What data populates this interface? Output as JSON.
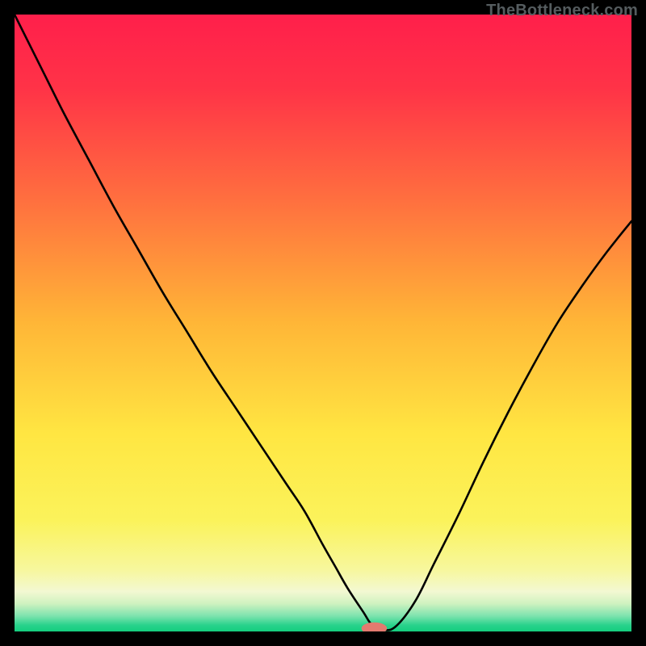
{
  "watermark": "TheBottleneck.com",
  "colors": {
    "frame": "#000000",
    "curve": "#000000",
    "marker_fill": "#E37A6F",
    "marker_stroke": "#E37A6F"
  },
  "chart_data": {
    "type": "line",
    "title": "",
    "xlabel": "",
    "ylabel": "",
    "xlim": [
      0,
      100
    ],
    "ylim": [
      0,
      100
    ],
    "annotations": [],
    "gradient_stops": [
      {
        "offset": 0.0,
        "color": "#FF1F4B"
      },
      {
        "offset": 0.12,
        "color": "#FF3347"
      },
      {
        "offset": 0.3,
        "color": "#FF6F3F"
      },
      {
        "offset": 0.5,
        "color": "#FFB637"
      },
      {
        "offset": 0.68,
        "color": "#FFE642"
      },
      {
        "offset": 0.82,
        "color": "#FBF35B"
      },
      {
        "offset": 0.9,
        "color": "#F7F79D"
      },
      {
        "offset": 0.935,
        "color": "#F3F8D2"
      },
      {
        "offset": 0.955,
        "color": "#CFF2C0"
      },
      {
        "offset": 0.975,
        "color": "#7CE3AE"
      },
      {
        "offset": 0.99,
        "color": "#28D28B"
      },
      {
        "offset": 1.0,
        "color": "#14CE7F"
      }
    ],
    "series": [
      {
        "name": "bottleneck-curve",
        "x": [
          0.0,
          2,
          5,
          8,
          12,
          16,
          20,
          24,
          28,
          32,
          36,
          40,
          44,
          47,
          50,
          52,
          54,
          56.5,
          58,
          60,
          62,
          65,
          68,
          72,
          76,
          80,
          84,
          88,
          92,
          96,
          100
        ],
        "y": [
          100,
          96,
          90,
          84,
          76.5,
          69,
          62,
          55,
          48.5,
          42,
          36,
          30,
          24,
          19.5,
          14,
          10.5,
          7,
          3.2,
          1.0,
          0.2,
          1.0,
          5,
          11,
          19,
          27.5,
          35.5,
          43,
          50,
          56,
          61.5,
          66.5
        ]
      }
    ],
    "marker": {
      "x": 58.3,
      "y": 0.5,
      "rx": 2.0,
      "ry": 0.9
    }
  }
}
